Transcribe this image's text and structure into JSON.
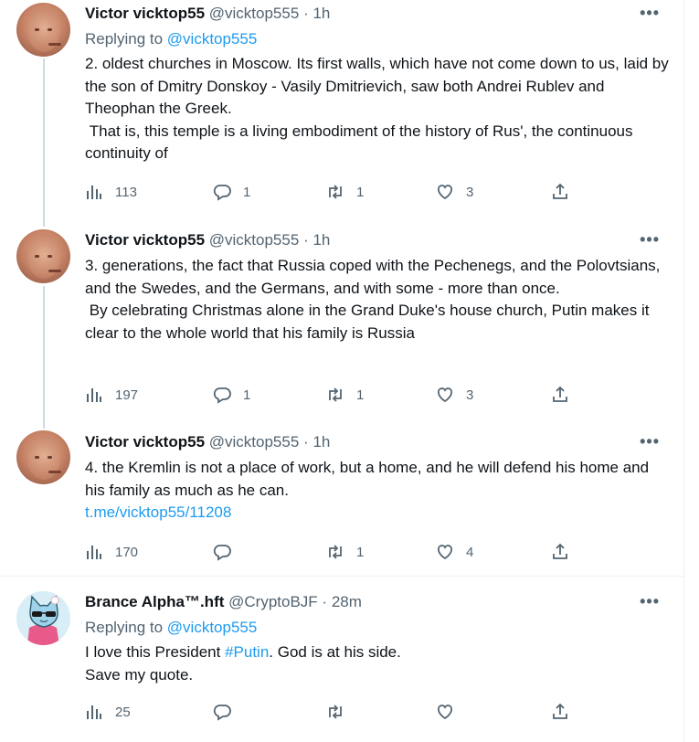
{
  "tweets": [
    {
      "name": "Victor vicktop55",
      "handle": "@vicktop555",
      "sep": "·",
      "time": "1h",
      "replying_prefix": "Replying to",
      "replying_to": "@vicktop555",
      "lines": [
        "2. oldest churches in Moscow.  Its first walls, which have not come down to us, laid by the son of Dmitry Donskoy - Vasily Dmitrievich, saw both Andrei Rublev and Theophan the Greek.",
        " That is, this temple is a living embodiment of the history of Rus', the continuous continuity of"
      ],
      "views": "113",
      "replies": "1",
      "retweets": "1",
      "likes": "3"
    },
    {
      "name": "Victor vicktop55",
      "handle": "@vicktop555",
      "sep": "·",
      "time": "1h",
      "lines": [
        "3. generations, the fact that Russia coped with the Pechenegs, and the Polovtsians, and the Swedes, and the Germans, and with some - more than once.",
        " By celebrating Christmas alone in the Grand Duke's house church, Putin makes it clear to the whole world that his family is Russia"
      ],
      "views": "197",
      "replies": "1",
      "retweets": "1",
      "likes": "3"
    },
    {
      "name": "Victor vicktop55",
      "handle": "@vicktop555",
      "sep": "·",
      "time": "1h",
      "lines": [
        "4. the Kremlin is not a place of work, but a home, and he will defend his home and his family as much as he can."
      ],
      "link": "t.me/vicktop55/11208",
      "views": "170",
      "replies": "",
      "retweets": "1",
      "likes": "4"
    },
    {
      "name": "Brance Alpha™.hft",
      "handle": "@CryptoBJF",
      "sep": "·",
      "time": "28m",
      "replying_prefix": "Replying to",
      "replying_to": "@vicktop555",
      "text_before": "I love this President ",
      "hashtag": "#Putin",
      "text_after": ". God is at his side.",
      "line2": "Save my quote.",
      "views": "25",
      "replies": "",
      "retweets": "",
      "likes": ""
    }
  ],
  "more_label": "•••",
  "colors": {
    "link": "#1d9bf0",
    "muted": "#536471",
    "text": "#0f1419",
    "thread": "#cfd9de"
  },
  "icons": [
    "views-icon",
    "reply-icon",
    "retweet-icon",
    "like-icon",
    "share-icon",
    "more-icon"
  ]
}
